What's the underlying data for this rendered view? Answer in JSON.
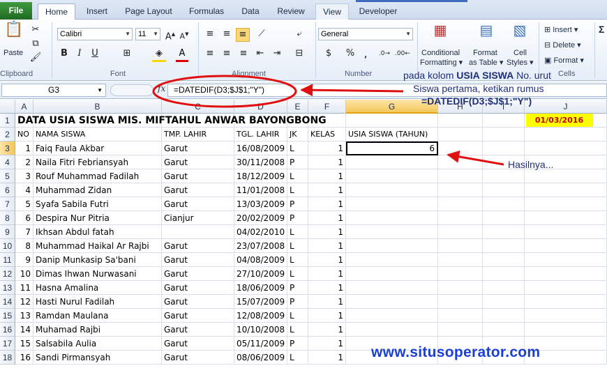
{
  "tabs": [
    "File",
    "Home",
    "Insert",
    "Page Layout",
    "Formulas",
    "Data",
    "Review",
    "View",
    "Developer"
  ],
  "ribbon": {
    "clipboard": {
      "label": "Clipboard",
      "paste": "Paste"
    },
    "font": {
      "label": "Font",
      "name": "Calibri",
      "size": "11"
    },
    "alignment": {
      "label": "Alignment"
    },
    "number": {
      "label": "Number",
      "format": "General"
    },
    "styles": {
      "conditional": "Conditional",
      "formatting": "Formatting",
      "format": "Format",
      "as_table": "as Table",
      "cell": "Cell",
      "styles_lbl": "Styles"
    },
    "cells": {
      "insert": "Insert",
      "delete": "Delete",
      "format": "Format",
      "label": "Cells"
    },
    "sigma": "Σ"
  },
  "formula_bar": {
    "name_box": "G3",
    "fx": "fx",
    "formula": "=DATEDIF(D3;$J$1;\"Y\")"
  },
  "columns": [
    "A",
    "B",
    "C",
    "D",
    "E",
    "F",
    "G",
    "H",
    "I",
    "J"
  ],
  "title": "DATA USIA SISWA MIS. MIFTAHUL ANWAR BAYONGBONG",
  "date_ref": "01/03/2016",
  "headers": {
    "no": "NO",
    "nama": "NAMA SISWA",
    "tmp": "TMP. LAHIR",
    "tgl": "TGL. LAHIR",
    "jk": "JK",
    "kelas": "KELAS",
    "usia": "USIA SISWA (TAHUN)"
  },
  "rows": [
    {
      "row": "3",
      "no": "1",
      "nama": "Faiq Faula Akbar",
      "tmp": "Garut",
      "tgl": "16/08/2009",
      "jk": "L",
      "kelas": "1",
      "usia": "6"
    },
    {
      "row": "4",
      "no": "2",
      "nama": "Naila Fitri Febriansyah",
      "tmp": "Garut",
      "tgl": "30/11/2008",
      "jk": "P",
      "kelas": "1",
      "usia": ""
    },
    {
      "row": "5",
      "no": "3",
      "nama": "Rouf Muhammad Fadilah",
      "tmp": "Garut",
      "tgl": "18/12/2009",
      "jk": "L",
      "kelas": "1",
      "usia": ""
    },
    {
      "row": "6",
      "no": "4",
      "nama": "Muhammad Zidan",
      "tmp": "Garut",
      "tgl": "11/01/2008",
      "jk": "L",
      "kelas": "1",
      "usia": ""
    },
    {
      "row": "7",
      "no": "5",
      "nama": "Syafa Sabila Futri",
      "tmp": "Garut",
      "tgl": "13/03/2009",
      "jk": "P",
      "kelas": "1",
      "usia": ""
    },
    {
      "row": "8",
      "no": "6",
      "nama": "Despira Nur Pitria",
      "tmp": "Cianjur",
      "tgl": "20/02/2009",
      "jk": "P",
      "kelas": "1",
      "usia": ""
    },
    {
      "row": "9",
      "no": "7",
      "nama": "Ikhsan Abdul fatah",
      "tmp": "",
      "tgl": "04/02/2010",
      "jk": "L",
      "kelas": "1",
      "usia": ""
    },
    {
      "row": "10",
      "no": "8",
      "nama": "Muhammad Haikal Ar Rajbi",
      "tmp": "Garut",
      "tgl": "23/07/2008",
      "jk": "L",
      "kelas": "1",
      "usia": ""
    },
    {
      "row": "11",
      "no": "9",
      "nama": "Danip Munkasip Sa'bani",
      "tmp": "Garut",
      "tgl": "04/08/2009",
      "jk": "L",
      "kelas": "1",
      "usia": ""
    },
    {
      "row": "12",
      "no": "10",
      "nama": "Dimas Ihwan Nurwasani",
      "tmp": "Garut",
      "tgl": "27/10/2009",
      "jk": "L",
      "kelas": "1",
      "usia": ""
    },
    {
      "row": "13",
      "no": "11",
      "nama": "Hasna Amalina",
      "tmp": "Garut",
      "tgl": "18/06/2009",
      "jk": "P",
      "kelas": "1",
      "usia": ""
    },
    {
      "row": "14",
      "no": "12",
      "nama": "Hasti Nurul Fadilah",
      "tmp": "Garut",
      "tgl": "15/07/2009",
      "jk": "P",
      "kelas": "1",
      "usia": ""
    },
    {
      "row": "15",
      "no": "13",
      "nama": "Ramdan Maulana",
      "tmp": "Garut",
      "tgl": "12/08/2009",
      "jk": "L",
      "kelas": "1",
      "usia": ""
    },
    {
      "row": "16",
      "no": "14",
      "nama": "Muhamad Rajbi",
      "tmp": "Garut",
      "tgl": "10/10/2008",
      "jk": "L",
      "kelas": "1",
      "usia": ""
    },
    {
      "row": "17",
      "no": "15",
      "nama": "Salsabila Aulia",
      "tmp": "Garut",
      "tgl": "05/11/2009",
      "jk": "P",
      "kelas": "1",
      "usia": ""
    },
    {
      "row": "18",
      "no": "16",
      "nama": "Sandi Pirmansyah",
      "tmp": "Garut",
      "tgl": "08/06/2009",
      "jk": "L",
      "kelas": "1",
      "usia": ""
    }
  ],
  "annotations": {
    "line1_pre": "pada kolom ",
    "line1_bold": "USIA SISWA",
    "line1_post": " No. urut",
    "line2": "Siswa pertama, ketikan rumus",
    "line3": "=DATEDIF(D3;$J$1;\"Y\")",
    "result": "Hasilnya..."
  },
  "watermark": "www.situsoperator.com",
  "colors": {
    "file_tab": "#2a7a2e",
    "arrow": "#e01010",
    "watermark": "#1a3fd6",
    "highlight": "#ffff00"
  }
}
